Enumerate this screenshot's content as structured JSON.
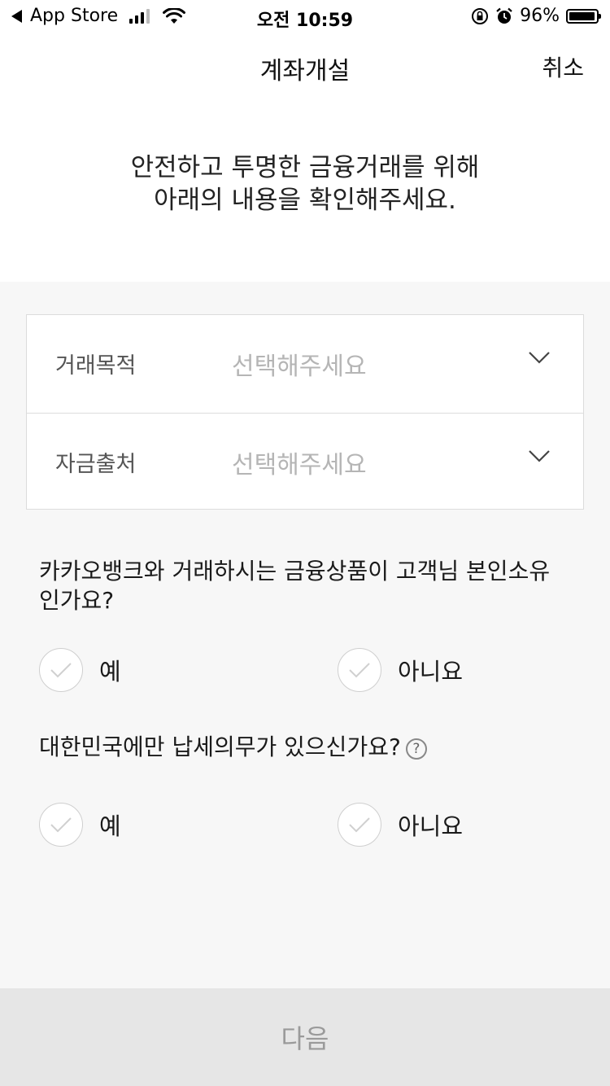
{
  "status_bar": {
    "back_app": "App Store",
    "time": "오전 10:59",
    "battery": "96%",
    "battery_level": 0.96
  },
  "nav": {
    "title": "계좌개설",
    "cancel": "취소"
  },
  "intro": {
    "line1": "안전하고 투명한 금융거래를 위해",
    "line2": "아래의 내용을 확인해주세요."
  },
  "selects": [
    {
      "label": "거래목적",
      "placeholder": "선택해주세요"
    },
    {
      "label": "자금출처",
      "placeholder": "선택해주세요"
    }
  ],
  "questions": [
    {
      "text": "카카오뱅크와 거래하시는 금융상품이 고객님 본인소유인가요?",
      "options": [
        "예",
        "아니요"
      ]
    },
    {
      "text": "대한민국에만 납세의무가 있으신가요?",
      "help": "?",
      "options": [
        "예",
        "아니요"
      ]
    }
  ],
  "next_button": "다음"
}
